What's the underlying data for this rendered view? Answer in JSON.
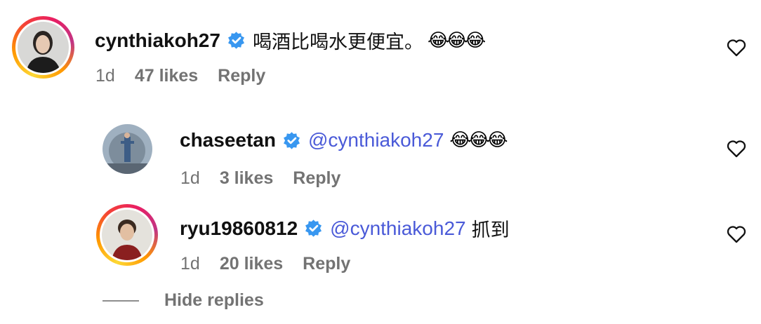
{
  "comments": [
    {
      "username": "cynthiakoh27",
      "mention": "",
      "text": "喝酒比喝水更便宜。",
      "emojis": "😂😂😂",
      "time": "1d",
      "likes": "47 likes",
      "reply": "Reply",
      "verified": true
    },
    {
      "username": "chaseetan",
      "mention": "@cynthiakoh27",
      "text": "",
      "emojis": "😂😂😂",
      "time": "1d",
      "likes": "3 likes",
      "reply": "Reply",
      "verified": true
    },
    {
      "username": "ryu19860812",
      "mention": "@cynthiakoh27",
      "text": "抓到",
      "emojis": "",
      "time": "1d",
      "likes": "20 likes",
      "reply": "Reply",
      "verified": true
    }
  ],
  "hide_replies": "Hide replies",
  "colors": {
    "mention": "#4a5ad8",
    "verified": "#3897f0",
    "meta": "#737373"
  },
  "icons": {
    "verified": "verified-badge-icon",
    "like": "heart-icon"
  }
}
